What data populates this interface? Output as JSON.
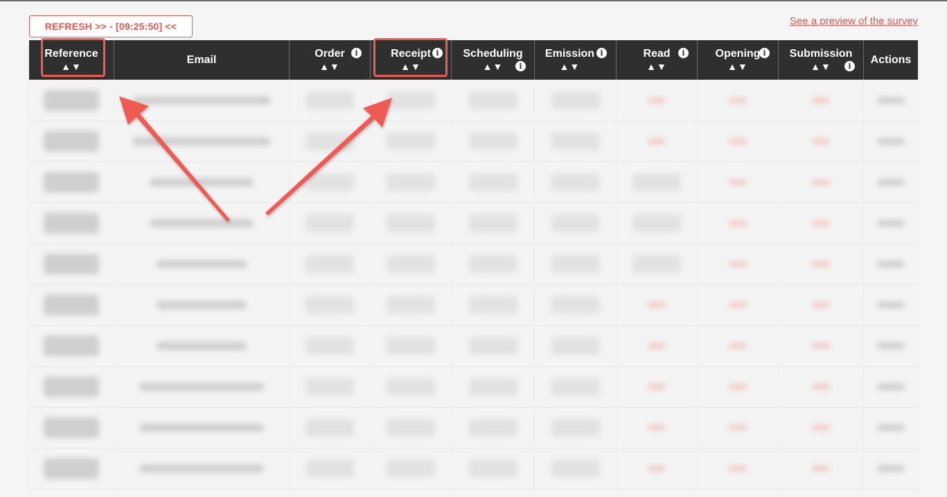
{
  "toolbar": {
    "refresh_label": "REFRESH >> - [09:25:50] <<",
    "preview_link": "See a preview of the survey"
  },
  "table": {
    "columns": [
      {
        "label": "Reference",
        "sortable": true,
        "info": false
      },
      {
        "label": "Email",
        "sortable": false,
        "info": false
      },
      {
        "label": "Order",
        "sortable": true,
        "info": true
      },
      {
        "label": "Receipt",
        "sortable": true,
        "info": true
      },
      {
        "label": "Scheduling",
        "sortable": true,
        "info": true
      },
      {
        "label": "Emission",
        "sortable": true,
        "info": true
      },
      {
        "label": "Read",
        "sortable": true,
        "info": true
      },
      {
        "label": "Opening",
        "sortable": true,
        "info": true
      },
      {
        "label": "Submission",
        "sortable": true,
        "info": true
      },
      {
        "label": "Actions",
        "sortable": false,
        "info": false
      }
    ],
    "sort_arrows": "▲▼",
    "info_glyph": "i",
    "row_count_visible": 10
  },
  "colors": {
    "accent": "#e8584f",
    "header_bg": "#2f2f2f",
    "annotation": "#ef5a52"
  },
  "icons": [
    "info-icon",
    "sort-arrows-icon"
  ]
}
